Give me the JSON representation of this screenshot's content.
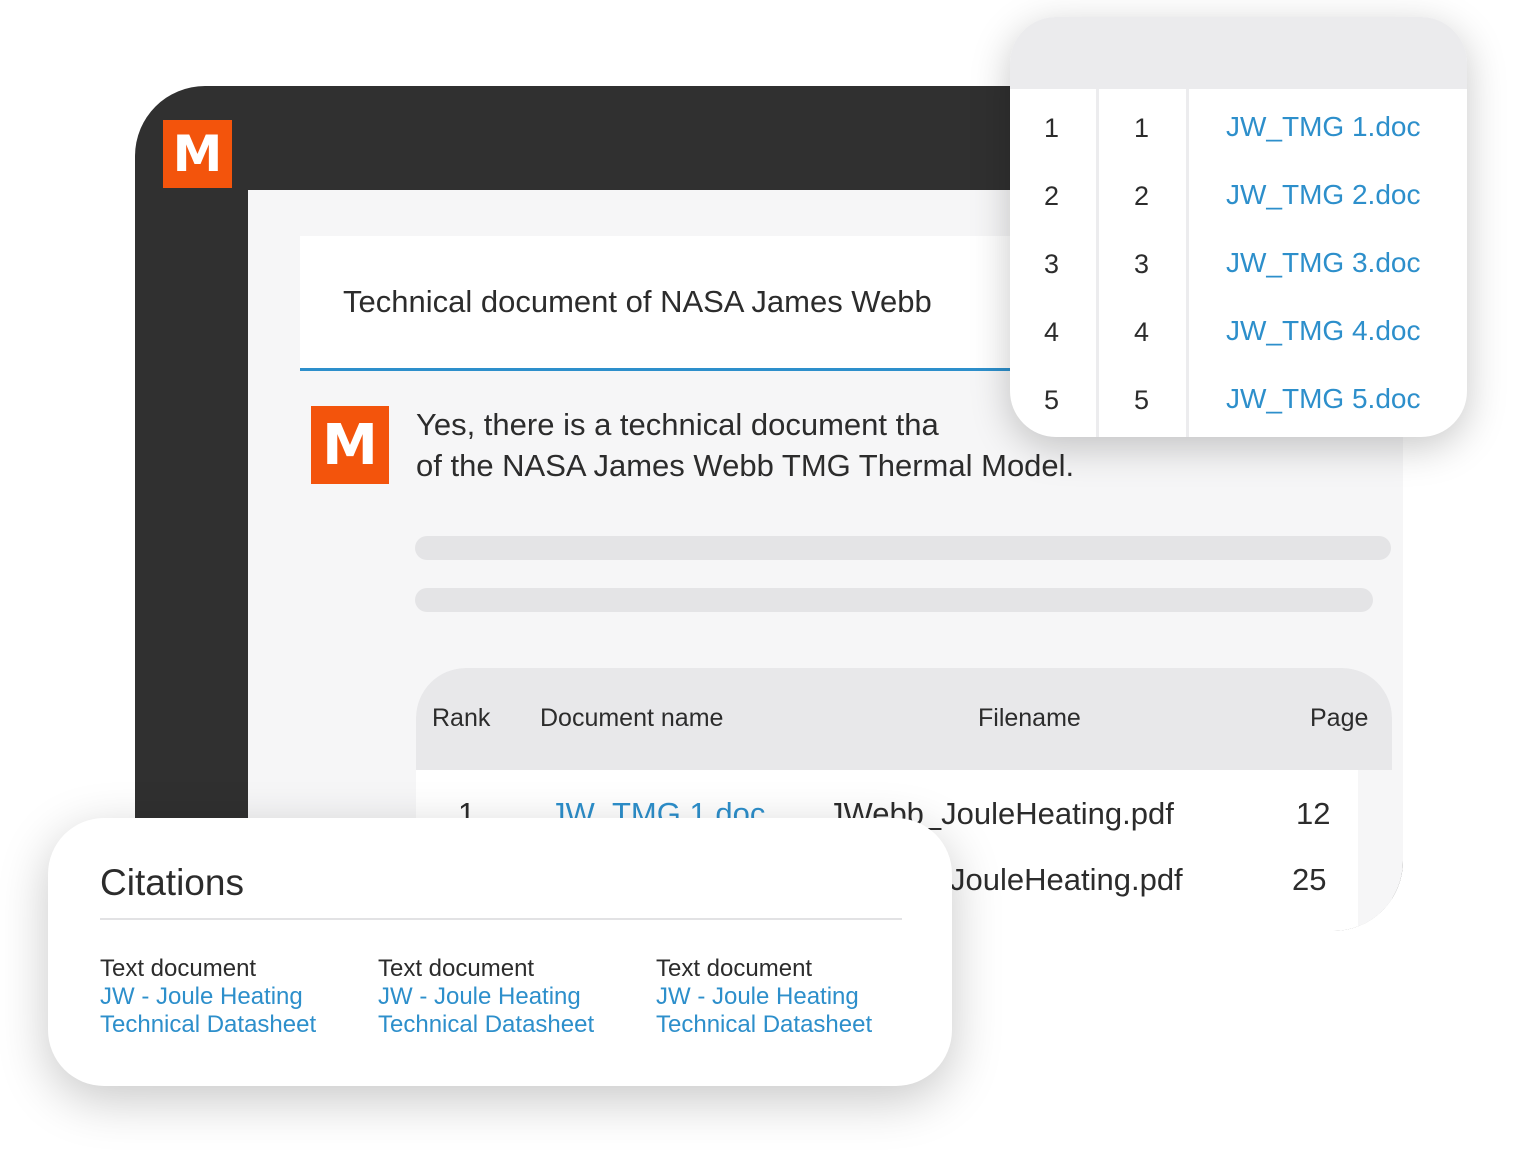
{
  "app": {
    "logo_letter": "M"
  },
  "query": {
    "text": "Technical document of NASA James Webb"
  },
  "answer": {
    "text": "Yes, there is a technical document tha   of the NASA James Webb TMG Thermal Model."
  },
  "results": {
    "headers": {
      "rank": "Rank",
      "document": "Document name",
      "filename": "Filename",
      "page": "Page"
    },
    "rows": [
      {
        "rank": "1",
        "document": "JW_TMG 1.doc",
        "filename": "JWebb_JouleHeating.pdf",
        "page": "12"
      },
      {
        "rank": "",
        "document": "",
        "filename": "JouleHeating.pdf",
        "page": "25"
      }
    ]
  },
  "doc_table": {
    "rows": [
      {
        "col1": "1",
        "col2": "1",
        "name": "JW_TMG 1.doc"
      },
      {
        "col1": "2",
        "col2": "2",
        "name": "JW_TMG 2.doc"
      },
      {
        "col1": "3",
        "col2": "3",
        "name": "JW_TMG 3.doc"
      },
      {
        "col1": "4",
        "col2": "4",
        "name": "JW_TMG 4.doc"
      },
      {
        "col1": "5",
        "col2": "5",
        "name": "JW_TMG 5.doc"
      }
    ]
  },
  "citations": {
    "title": "Citations",
    "items": [
      {
        "type": "Text document",
        "line1": "JW - Joule Heating",
        "line2": "Technical Datasheet"
      },
      {
        "type": "Text document",
        "line1": "JW - Joule Heating",
        "line2": "Technical Datasheet"
      },
      {
        "type": "Text document",
        "line1": "JW - Joule Heating",
        "line2": "Technical Datasheet"
      }
    ]
  },
  "colors": {
    "accent": "#f3540c",
    "link": "#2d8fcb",
    "frame": "#303030"
  }
}
